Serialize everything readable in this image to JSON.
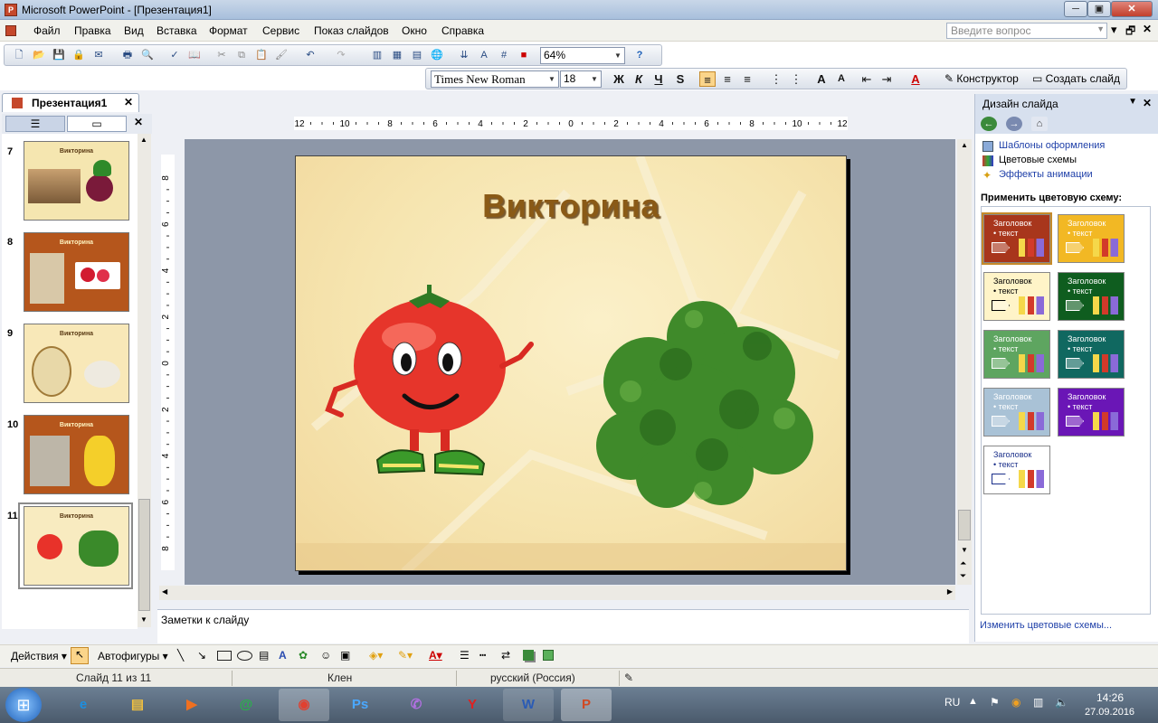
{
  "window": {
    "title": "Microsoft PowerPoint - [Презентация1]"
  },
  "menu": [
    "Файл",
    "Правка",
    "Вид",
    "Вставка",
    "Формат",
    "Сервис",
    "Показ слайдов",
    "Окно",
    "Справка"
  ],
  "help_search": {
    "placeholder": "Введите вопрос"
  },
  "toolbar": {
    "zoom": "64%",
    "font_name": "Times New Roman",
    "font_size": "18",
    "bold": "Ж",
    "italic": "К",
    "underline": "Ч",
    "shadow": "S",
    "designer_label": "Конструктор",
    "new_slide_label": "Создать слайд"
  },
  "doc_tab": {
    "label": "Презентация1"
  },
  "thumbnails": [
    {
      "num": "7",
      "title": "Викторина",
      "colors": {
        "bg": "#f5e6b0",
        "border": "#f0d89a"
      }
    },
    {
      "num": "8",
      "title": "Викторина",
      "colors": {
        "bg": "#b5561c",
        "border": "#8f3c0e"
      }
    },
    {
      "num": "9",
      "title": "Викторина",
      "colors": {
        "bg": "#f8e8b8",
        "border": "#efd495"
      }
    },
    {
      "num": "10",
      "title": "Викторина",
      "colors": {
        "bg": "#b5561c",
        "border": "#8f3c0e"
      }
    },
    {
      "num": "11",
      "title": "Викторина",
      "colors": {
        "bg": "#f8ebc0",
        "border": "#efd9a0"
      }
    }
  ],
  "ruler": {
    "h_labels": [
      "12",
      "10",
      "8",
      "6",
      "4",
      "2",
      "0",
      "2",
      "4",
      "6",
      "8",
      "10",
      "12"
    ],
    "v_labels": [
      "8",
      "6",
      "4",
      "2",
      "0",
      "2",
      "4",
      "6",
      "8"
    ]
  },
  "slide": {
    "title": "Викторина"
  },
  "notes": {
    "text": "Заметки к слайду"
  },
  "task_pane": {
    "header": "Дизайн слайда",
    "links": [
      "Шаблоны оформления",
      "Цветовые схемы",
      "Эффекты анимации"
    ],
    "apply_label": "Применить цветовую схему:",
    "swatch_heading": "Заголовок",
    "swatch_text": "• текст",
    "swatches": [
      {
        "bg": "#a8361c",
        "fg": "#ffffff"
      },
      {
        "bg": "#f2b824",
        "fg": "#ffffff"
      },
      {
        "bg": "#fff4c8",
        "fg": "#000000"
      },
      {
        "bg": "#0f5d1f",
        "fg": "#ffffff"
      },
      {
        "bg": "#5ea560",
        "fg": "#ffffff"
      },
      {
        "bg": "#106860",
        "fg": "#ffffff"
      },
      {
        "bg": "#a9c2d6",
        "fg": "#ffffff"
      },
      {
        "bg": "#6a16b6",
        "fg": "#ffffff"
      },
      {
        "bg": "#ffffff",
        "fg": "#1a2f8a"
      }
    ],
    "edit_link": "Изменить цветовые схемы..."
  },
  "draw_toolbar": {
    "actions": "Действия",
    "autoshapes": "Автофигуры"
  },
  "status": {
    "slide": "Слайд 11 из 11",
    "design": "Клен",
    "language": "русский (Россия)"
  },
  "tray": {
    "lang": "RU",
    "time": "14:26",
    "date": "27.09.2016"
  }
}
